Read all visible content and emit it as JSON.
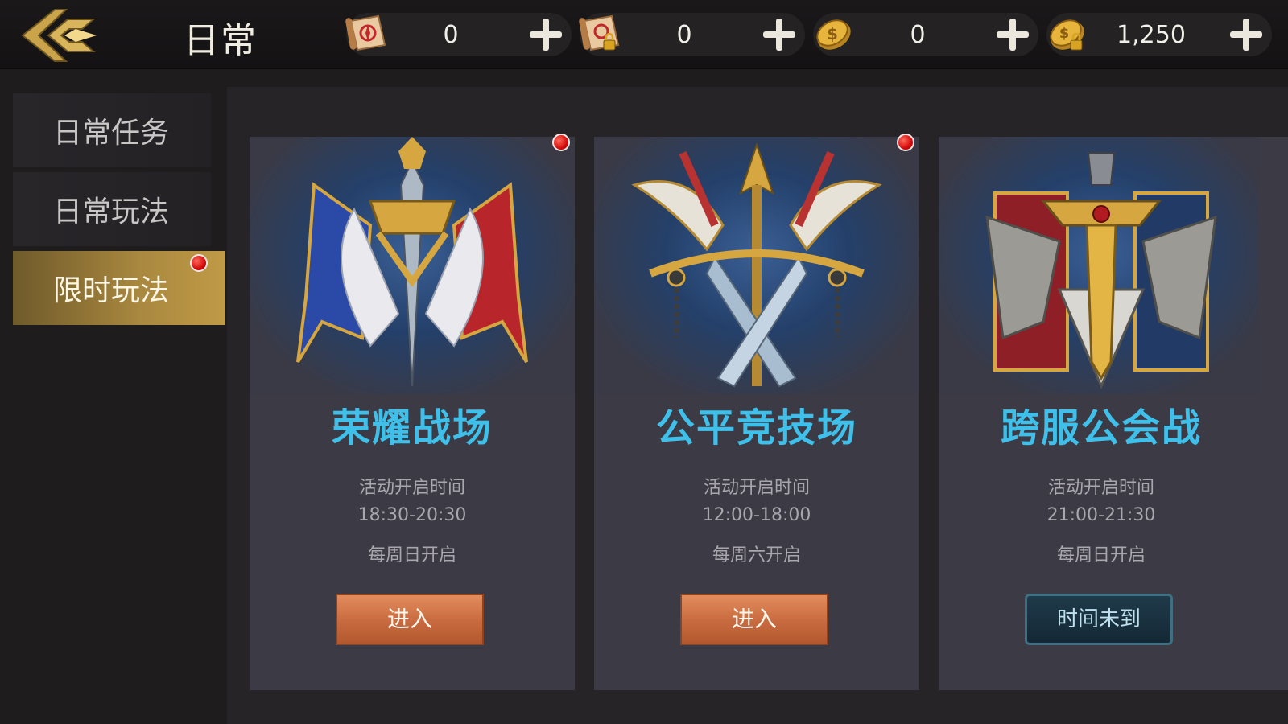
{
  "header": {
    "title": "日常",
    "back_icon": "back-arrow-icon",
    "resources": [
      {
        "icon": "scroll-icon",
        "value": "0"
      },
      {
        "icon": "locked-scroll-icon",
        "value": "0"
      },
      {
        "icon": "gold-coin-icon",
        "value": "0"
      },
      {
        "icon": "locked-gold-coin-icon",
        "value": "1,250"
      }
    ]
  },
  "sidebar": {
    "items": [
      {
        "label": "日常任务",
        "active": false
      },
      {
        "label": "日常玩法",
        "active": false
      },
      {
        "label": "限时玩法",
        "active": true,
        "badge": true
      }
    ]
  },
  "cards": [
    {
      "name": "荣耀战场",
      "emblem_icon": "glory-battlefield-emblem-icon",
      "time_label": "活动开启时间",
      "time": "18:30-20:30",
      "days": "每周日开启",
      "button": "进入",
      "button_state": "enter",
      "badge": true
    },
    {
      "name": "公平竞技场",
      "emblem_icon": "fair-arena-emblem-icon",
      "time_label": "活动开启时间",
      "time": "12:00-18:00",
      "days": "每周六开启",
      "button": "进入",
      "button_state": "enter",
      "badge": true
    },
    {
      "name": "跨服公会战",
      "emblem_icon": "cross-server-guild-war-emblem-icon",
      "time_label": "活动开启时间",
      "time": "21:00-21:30",
      "days": "每周日开启",
      "button": "时间未到",
      "button_state": "disabled",
      "badge": false
    }
  ],
  "colors": {
    "accent_gold": "#c09a45",
    "card_title": "#3fc0ea",
    "enter_button": "#c86a3f",
    "wait_button": "#142835",
    "badge_red": "#d40b0b"
  }
}
